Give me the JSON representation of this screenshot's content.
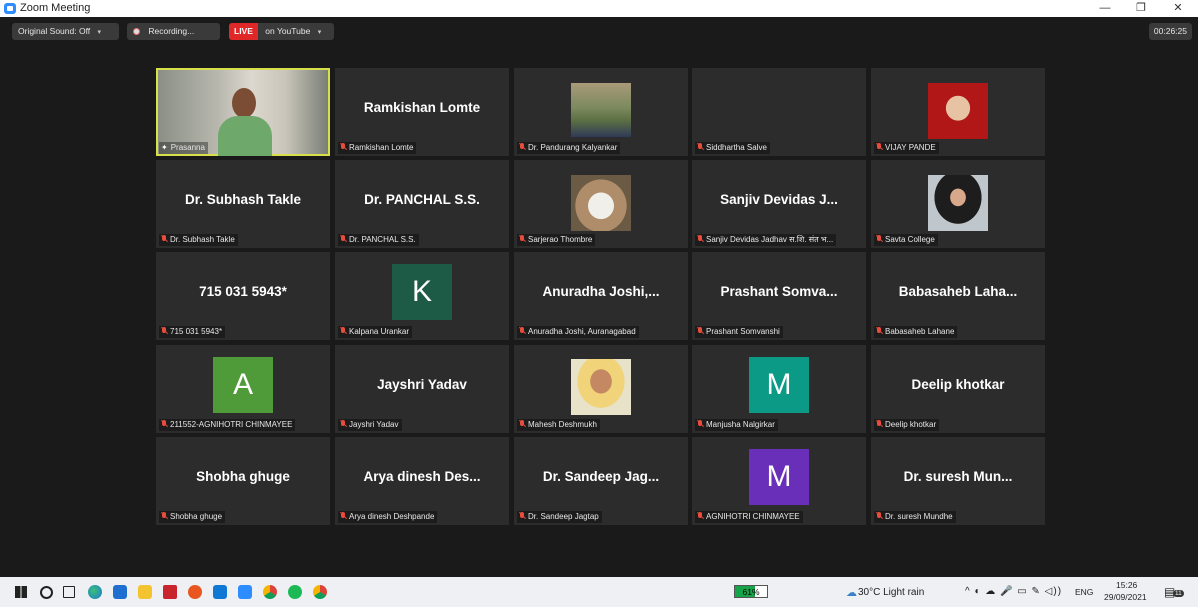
{
  "window": {
    "title": "Zoom Meeting",
    "min_glyph": "—",
    "max_glyph": "❐",
    "close_glyph": "✕"
  },
  "topbar": {
    "original_sound": "Original Sound: Off",
    "recording": "Recording...",
    "live": "LIVE",
    "youtube": "on YouTube",
    "timer": "00:26:25",
    "caret": "▾"
  },
  "tiles": [
    {
      "id": "prasanna",
      "name": "Prasanna",
      "display": "",
      "kind": "video",
      "pinned": true
    },
    {
      "id": "ramkishan",
      "name": "Ramkishan Lomte",
      "display": "Ramkishan Lomte",
      "kind": "name"
    },
    {
      "id": "pandurang",
      "name": "Dr. Pandurang Kalyankar",
      "display": "",
      "kind": "photo"
    },
    {
      "id": "siddhartha",
      "name": "Siddhartha Salve",
      "display": "",
      "kind": "blank"
    },
    {
      "id": "vijay",
      "name": "VIJAY PANDE",
      "display": "",
      "kind": "photo"
    },
    {
      "id": "subhash",
      "name": "Dr. Subhash Takle",
      "display": "Dr. Subhash Takle",
      "kind": "name"
    },
    {
      "id": "panchal",
      "name": "Dr. PANCHAL S.S.",
      "display": "Dr. PANCHAL S.S.",
      "kind": "name"
    },
    {
      "id": "sarjerao",
      "name": "Sarjerao Thombre",
      "display": "",
      "kind": "photo"
    },
    {
      "id": "sanjiv",
      "name": "Sanjiv Devidas Jadhav स.शि. संत भ...",
      "display": "Sanjiv Devidas J...",
      "kind": "name"
    },
    {
      "id": "savta",
      "name": "Savta College",
      "display": "",
      "kind": "photo"
    },
    {
      "id": "phone",
      "name": "715 031 5943*",
      "display": "715 031 5943*",
      "kind": "name"
    },
    {
      "id": "kalpana",
      "name": "Kalpana Urankar",
      "display": "K",
      "kind": "avatar",
      "color": "#1e5b47"
    },
    {
      "id": "anuradha",
      "name": "Anuradha Joshi, Auranagabad",
      "display": "Anuradha Joshi,...",
      "kind": "name"
    },
    {
      "id": "prashant",
      "name": "Prashant Somvanshi",
      "display": "Prashant Somva...",
      "kind": "name"
    },
    {
      "id": "babasaheb",
      "name": "Babasaheb Lahane",
      "display": "Babasaheb Laha...",
      "kind": "name"
    },
    {
      "id": "agnihotri1",
      "name": "211552-AGNIHOTRI CHINMAYEE",
      "display": "A",
      "kind": "avatar",
      "color": "#4f9b3a"
    },
    {
      "id": "jayshri",
      "name": "Jayshri Yadav",
      "display": "Jayshri Yadav",
      "kind": "name"
    },
    {
      "id": "mahesh",
      "name": "Mahesh Deshmukh",
      "display": "",
      "kind": "photo"
    },
    {
      "id": "manjusha",
      "name": "Manjusha Nalgirkar",
      "display": "M",
      "kind": "avatar",
      "color": "#0a9a86"
    },
    {
      "id": "deelip",
      "name": "Deelip khotkar",
      "display": "Deelip khotkar",
      "kind": "name"
    },
    {
      "id": "shobha",
      "name": "Shobha ghuge",
      "display": "Shobha ghuge",
      "kind": "name"
    },
    {
      "id": "arya",
      "name": "Arya dinesh Deshpande",
      "display": "Arya dinesh Des...",
      "kind": "name"
    },
    {
      "id": "sandeep",
      "name": "Dr. Sandeep Jagtap",
      "display": "Dr. Sandeep Jag...",
      "kind": "name"
    },
    {
      "id": "agnihotri2",
      "name": "AGNIHOTRI CHINMAYEE",
      "display": "M",
      "kind": "avatar",
      "color": "#6a2fb8"
    },
    {
      "id": "suresh",
      "name": "Dr. suresh Mundhe",
      "display": "Dr. suresh Mun...",
      "kind": "name"
    }
  ],
  "taskbar": {
    "icons": [
      "windows-icon",
      "search-icon",
      "task-view-icon",
      "edge-icon",
      "mail-icon",
      "file-explorer-icon",
      "mcafee-icon",
      "office-icon",
      "outlook-icon",
      "zoom-icon",
      "chrome-icon",
      "spotify-icon",
      "chrome-profile-icon"
    ],
    "battery": "61%",
    "battery_level": 0.61,
    "weather": "30°C  Light rain",
    "tray": "^  ◐  ☁  🎤  ▭  ✎  ◁))",
    "lang": "ENG",
    "time": "15:26",
    "date": "29/09/2021",
    "notification_badge": "11"
  }
}
